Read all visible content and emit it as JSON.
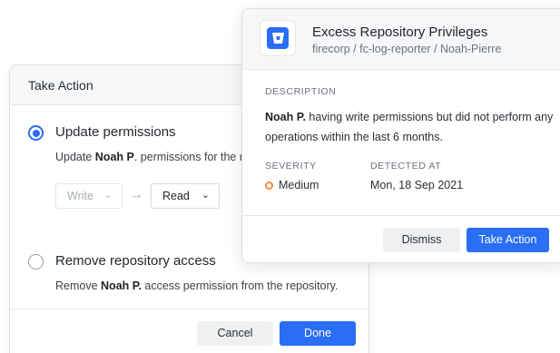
{
  "take_action": {
    "title": "Take Action",
    "update_option": {
      "title": "Update permissions",
      "desc_prefix": "Update ",
      "desc_user": "Noah P",
      "desc_suffix": ". permissions for the repository.",
      "from_value": "Write",
      "to_value": "Read",
      "selected": true
    },
    "remove_option": {
      "title": "Remove repository access",
      "desc_prefix": "Remove ",
      "desc_user": "Noah P.",
      "desc_suffix": " access permission from the repository.",
      "selected": false
    },
    "cancel_label": "Cancel",
    "done_label": "Done"
  },
  "detail": {
    "title": "Excess Repository Privileges",
    "subtitle": "firecorp / fc-log-reporter / Noah-Pierre",
    "description_label": "DESCRIPTION",
    "description_user": "Noah P.",
    "description_text": " having write permissions but did not perform any operations within the last 6 months.",
    "severity_label": "SEVERITY",
    "severity_value": "Medium",
    "severity_color": "#f0913b",
    "detected_label": "DETECTED AT",
    "detected_value": "Mon, 18 Sep 2021",
    "dismiss_label": "Dismiss",
    "take_action_label": "Take Action",
    "accent_color": "#2b6ef6"
  }
}
